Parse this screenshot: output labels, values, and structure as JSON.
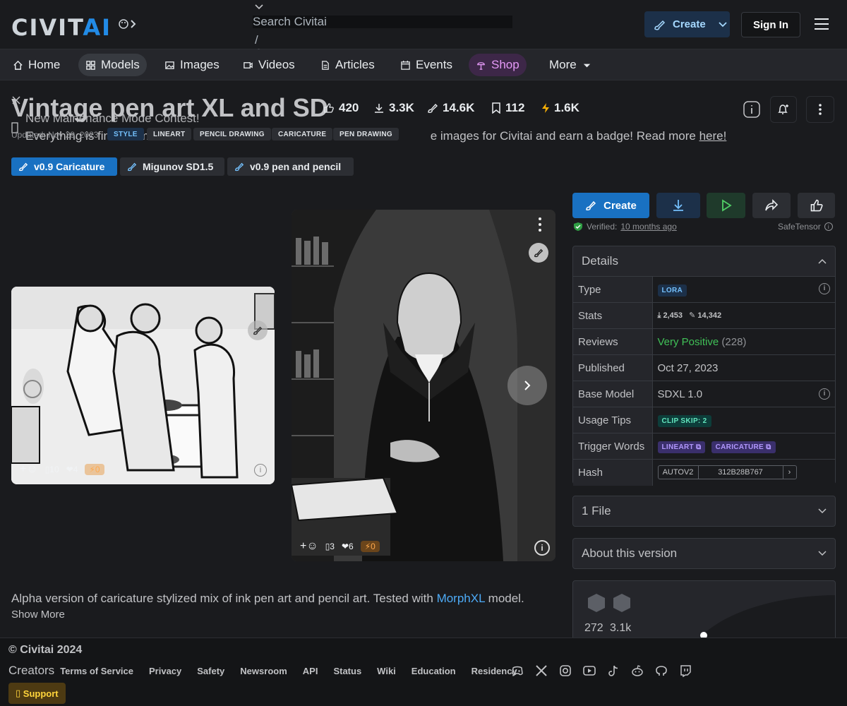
{
  "header": {
    "logo_left": "CIVIT",
    "logo_right": "AI",
    "search_placeholder": "Search Civitai",
    "search_shortcut": "/",
    "create_label": "Create",
    "signin_label": "Sign In"
  },
  "nav": [
    {
      "label": "Home",
      "icon": "home-icon"
    },
    {
      "label": "Models",
      "icon": "grid-icon",
      "active": true
    },
    {
      "label": "Images",
      "icon": "photo-icon"
    },
    {
      "label": "Videos",
      "icon": "video-icon"
    },
    {
      "label": "Articles",
      "icon": "article-icon"
    },
    {
      "label": "Events",
      "icon": "calendar-icon"
    },
    {
      "label": "Shop",
      "icon": "shop-icon"
    },
    {
      "label": "More",
      "icon": "caret-down-icon"
    }
  ],
  "model": {
    "title": "Vintage pen art XL and SD",
    "likes": "420",
    "downloads": "3.3K",
    "generations": "14.6K",
    "bookmarks": "112",
    "buzz": "1.6K",
    "updated": "Updated: Nov 29, 2023",
    "tags": [
      "STYLE",
      "LINEART",
      "PENCIL DRAWING",
      "CARICATURE",
      "PEN DRAWING"
    ],
    "versions": [
      "v0.9 Caricature",
      "Migunov SD1.5",
      "v0.9 pen and pencil"
    ]
  },
  "banner": {
    "line1": "New Mainenance Mode Contest!",
    "line2_a": "Everything is fine. Come",
    "line2_b": "e images for Civitai and earn a badge! Read more",
    "link": "here!"
  },
  "gallery": [
    {
      "reactions": "10",
      "hearts": "4",
      "buzz": "0"
    },
    {
      "reactions": "3",
      "hearts": "6",
      "buzz": "0"
    }
  ],
  "description": {
    "text_before": "Alpha version of caricature stylized mix of ink pen art and pencil art. Tested with",
    "link": "MorphXL",
    "text_after": "model.",
    "show_more": "Show More"
  },
  "actions": {
    "create_label": "Create",
    "verified_label": "Verified:",
    "verified_time": "10 months ago",
    "file_format": "SafeTensor"
  },
  "details": {
    "heading": "Details",
    "rows": {
      "type_k": "Type",
      "type_v": "LORA",
      "stats_k": "Stats",
      "stats_downloads": "2,453",
      "stats_generations": "14,342",
      "reviews_k": "Reviews",
      "reviews_v": "Very Positive",
      "reviews_count": "(228)",
      "published_k": "Published",
      "published_v": "Oct 27, 2023",
      "base_k": "Base Model",
      "base_v": "SDXL 1.0",
      "usage_k": "Usage Tips",
      "usage_v": "CLIP SKIP: 2",
      "trigger_k": "Trigger Words",
      "trigger_1": "LINEART",
      "trigger_2": "CARICATURE",
      "hash_k": "Hash",
      "hash_type": "AUTOV2",
      "hash_v": "312B28B767"
    }
  },
  "files_panel": "1 File",
  "about_panel": "About this version",
  "creator_card": {
    "stat1": "272",
    "stat2": "3.1k"
  },
  "footer": {
    "copyright": "© Civitai 2024",
    "creators": "Creators",
    "links": [
      "Terms of Service",
      "Privacy",
      "Safety",
      "Newsroom",
      "API",
      "Status",
      "Wiki",
      "Education",
      "Residency"
    ],
    "support": "Support"
  },
  "colors": {
    "accent": "#228be6",
    "background": "#1a1b1e",
    "positive": "#40c057"
  }
}
